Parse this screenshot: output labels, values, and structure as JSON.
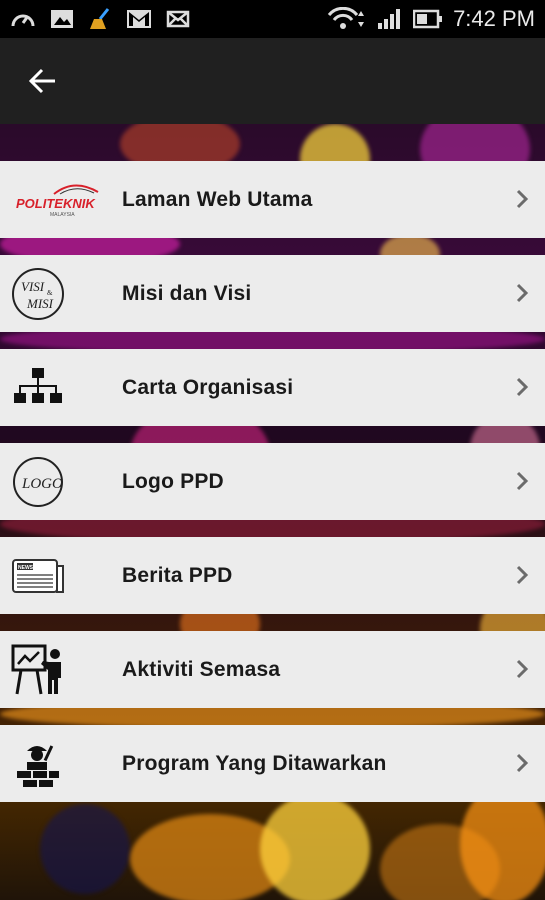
{
  "status_bar": {
    "time": "7:42 PM",
    "left_icons": [
      "speedometer-icon",
      "image-icon",
      "broom-icon",
      "gmail-icon",
      "mail-icon"
    ],
    "right_icons": [
      "wifi-icon",
      "signal-icon",
      "battery-icon"
    ]
  },
  "app_bar": {
    "back_icon": "arrow-left-icon"
  },
  "menu": {
    "items": [
      {
        "label": "Laman Web Utama",
        "icon": "politeknik-logo-icon"
      },
      {
        "label": "Misi dan Visi",
        "icon": "visi-misi-icon"
      },
      {
        "label": "Carta Organisasi",
        "icon": "org-chart-icon"
      },
      {
        "label": "Logo PPD",
        "icon": "logo-badge-icon",
        "icon_text": "LOGO"
      },
      {
        "label": "Berita PPD",
        "icon": "newspaper-icon",
        "icon_text": "NEWS"
      },
      {
        "label": "Aktiviti Semasa",
        "icon": "presenter-icon"
      },
      {
        "label": "Program Yang Ditawarkan",
        "icon": "worker-icon"
      }
    ]
  },
  "icon_texts": {
    "politeknik": "POLITEKNIK",
    "politeknik_sub": "MALAYSIA",
    "visi": "VISI",
    "misi": "MISI",
    "amp": "&"
  },
  "colors": {
    "app_bar": "#202020",
    "list_item": "#ececec",
    "text": "#1a1a1a",
    "chevron": "#6b6b6b",
    "brand_red": "#d8202a"
  }
}
